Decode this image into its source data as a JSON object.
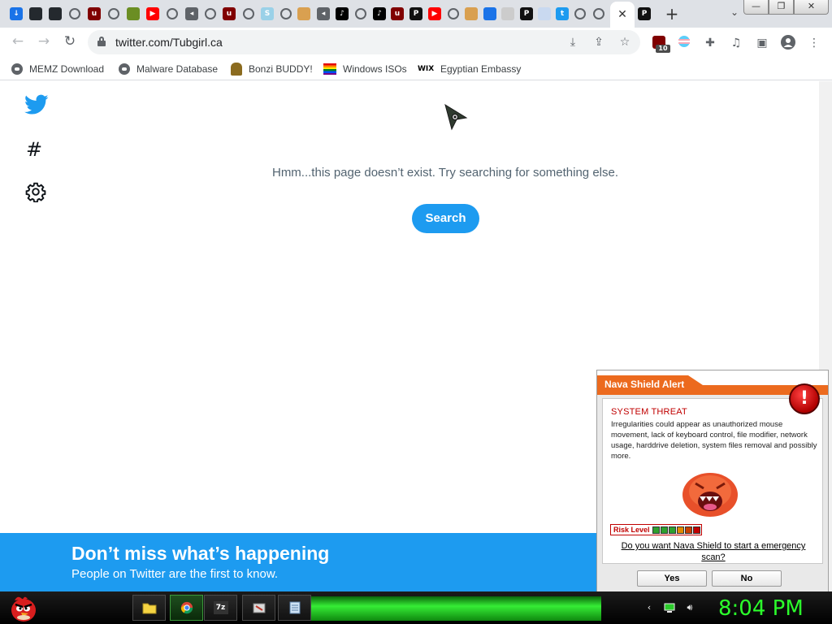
{
  "browser": {
    "tabs": [
      {
        "icon": "download-icon",
        "color": "#1a73e8",
        "glyph": "↓"
      },
      {
        "icon": "github-icon",
        "color": "#24292e",
        "glyph": ""
      },
      {
        "icon": "github-icon",
        "color": "#24292e",
        "glyph": ""
      },
      {
        "icon": "globe-icon",
        "color": "#5f6368",
        "glyph": ""
      },
      {
        "icon": "ublock-icon",
        "color": "#800000",
        "glyph": "u"
      },
      {
        "icon": "globe-icon",
        "color": "#5f6368",
        "glyph": ""
      },
      {
        "icon": "minecraft-icon",
        "color": "#6b8e23",
        "glyph": ""
      },
      {
        "icon": "youtube-icon",
        "color": "#ff0000",
        "glyph": "▶"
      },
      {
        "icon": "globe-icon",
        "color": "#5f6368",
        "glyph": ""
      },
      {
        "icon": "audio-icon",
        "color": "#5f6368",
        "glyph": "◂"
      },
      {
        "icon": "globe-icon",
        "color": "#5f6368",
        "glyph": ""
      },
      {
        "icon": "ublock-icon",
        "color": "#800000",
        "glyph": "u"
      },
      {
        "icon": "globe-icon",
        "color": "#5f6368",
        "glyph": ""
      },
      {
        "icon": "s-icon",
        "color": "#9ad1e8",
        "glyph": "S"
      },
      {
        "icon": "globe-icon",
        "color": "#5f6368",
        "glyph": ""
      },
      {
        "icon": "bonzi-icon",
        "color": "#d9a050",
        "glyph": ""
      },
      {
        "icon": "audio-icon",
        "color": "#5f6368",
        "glyph": "◂"
      },
      {
        "icon": "tiktok-icon",
        "color": "#000000",
        "glyph": "♪"
      },
      {
        "icon": "globe-icon",
        "color": "#5f6368",
        "glyph": ""
      },
      {
        "icon": "tiktok-icon",
        "color": "#000000",
        "glyph": "♪"
      },
      {
        "icon": "ublock-icon",
        "color": "#800000",
        "glyph": "u"
      },
      {
        "icon": "psn-icon",
        "color": "#111111",
        "glyph": "P"
      },
      {
        "icon": "youtube-icon",
        "color": "#ff0000",
        "glyph": "▶"
      },
      {
        "icon": "globe-icon",
        "color": "#5f6368",
        "glyph": ""
      },
      {
        "icon": "bonzi-icon",
        "color": "#d9a050",
        "glyph": ""
      },
      {
        "icon": "square-icon",
        "color": "#1a73e8",
        "glyph": ""
      },
      {
        "icon": "document-icon",
        "color": "#cccccc",
        "glyph": ""
      },
      {
        "icon": "psn-icon",
        "color": "#111111",
        "glyph": "P"
      },
      {
        "icon": "loading-icon",
        "color": "#c9d9f0",
        "glyph": ""
      },
      {
        "icon": "twitter-icon",
        "color": "#1d9bf0",
        "glyph": "t"
      },
      {
        "icon": "globe-icon",
        "color": "#5f6368",
        "glyph": ""
      },
      {
        "icon": "globe-icon",
        "color": "#5f6368",
        "glyph": ""
      },
      {
        "icon": "twitter-icon",
        "color": "#1d9bf0",
        "glyph": "t"
      }
    ],
    "active_tab_close": "✕",
    "after_tabs": [
      {
        "icon": "psn-icon",
        "color": "#111111",
        "glyph": "P"
      }
    ],
    "new_tab": "+",
    "tab_search": "⌄",
    "window_buttons": {
      "minimize": "—",
      "restore": "❐",
      "close": "✕"
    },
    "url": "twitter.com/Tubgirl.ca",
    "extension_badge": "10",
    "bookmarks": [
      {
        "icon": "globe-icon",
        "label": "MEMZ Download"
      },
      {
        "icon": "globe-icon",
        "label": "Malware Database"
      },
      {
        "icon": "bonzi-icon",
        "label": "Bonzi BUDDY!"
      },
      {
        "icon": "rainbow-flag-icon",
        "label": "Windows ISOs"
      },
      {
        "icon": "wix-icon",
        "label": "Egyptian Embassy",
        "glyph": "WIX"
      }
    ]
  },
  "twitter": {
    "hash_glyph": "#",
    "not_found_text": "Hmm...this page doesn’t exist. Try searching for something else.",
    "search_button": "Search",
    "banner_title": "Don’t miss what’s happening",
    "banner_subtitle": "People on Twitter are the first to know.",
    "brand_color": "#1d9bf0"
  },
  "popup": {
    "title": "Nava Shield Alert",
    "alert_glyph": "!",
    "threat_title": "SYSTEM THREAT",
    "threat_text": "Irregularities could appear as unauthorized mouse movement, lack of keyboard control, file modifier, network usage, harddrive deletion, system files removal and possibly more.",
    "risk_label": "Risk Level",
    "risk_segments": [
      "#2ea02e",
      "#2ea02e",
      "#2ea02e",
      "#e08a00",
      "#c84000",
      "#c00000"
    ],
    "question": "Do you want Nava Shield to start a emergency scan?",
    "yes": "Yes",
    "no": "No",
    "accent": "#ec6a1e"
  },
  "taskbar": {
    "clock": "8:04 PM",
    "apps": [
      {
        "name": "file-explorer-icon",
        "color": "#f5d442"
      },
      {
        "name": "chrome-icon",
        "color": "#4285f4"
      },
      {
        "name": "seven-zip-icon",
        "color": "#222222",
        "glyph": "7z"
      },
      {
        "name": "paint-icon",
        "color": "#b0b0b0"
      },
      {
        "name": "notepad-icon",
        "color": "#8fb8e0"
      }
    ],
    "clock_color": "#2bff2b"
  }
}
